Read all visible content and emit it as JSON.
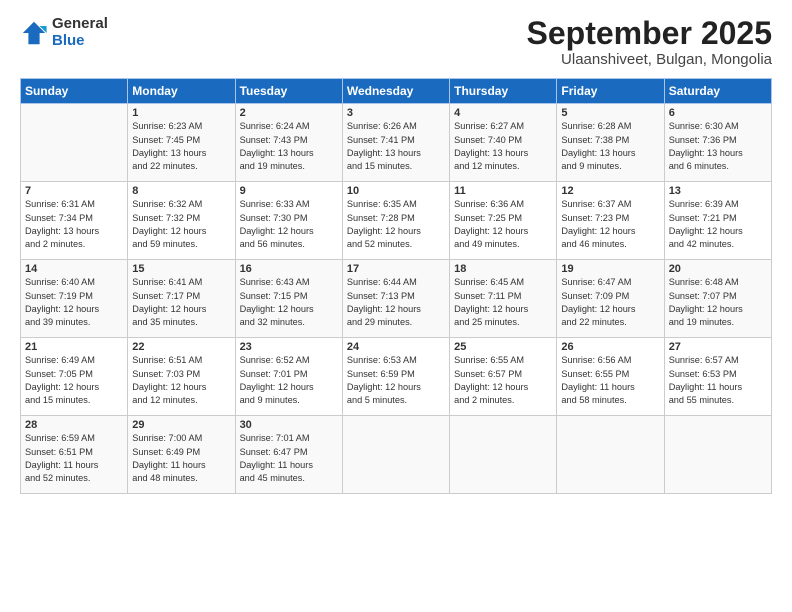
{
  "logo": {
    "general": "General",
    "blue": "Blue"
  },
  "title": "September 2025",
  "subtitle": "Ulaanshiveet, Bulgan, Mongolia",
  "days_header": [
    "Sunday",
    "Monday",
    "Tuesday",
    "Wednesday",
    "Thursday",
    "Friday",
    "Saturday"
  ],
  "weeks": [
    [
      {
        "day": "",
        "content": ""
      },
      {
        "day": "1",
        "content": "Sunrise: 6:23 AM\nSunset: 7:45 PM\nDaylight: 13 hours\nand 22 minutes."
      },
      {
        "day": "2",
        "content": "Sunrise: 6:24 AM\nSunset: 7:43 PM\nDaylight: 13 hours\nand 19 minutes."
      },
      {
        "day": "3",
        "content": "Sunrise: 6:26 AM\nSunset: 7:41 PM\nDaylight: 13 hours\nand 15 minutes."
      },
      {
        "day": "4",
        "content": "Sunrise: 6:27 AM\nSunset: 7:40 PM\nDaylight: 13 hours\nand 12 minutes."
      },
      {
        "day": "5",
        "content": "Sunrise: 6:28 AM\nSunset: 7:38 PM\nDaylight: 13 hours\nand 9 minutes."
      },
      {
        "day": "6",
        "content": "Sunrise: 6:30 AM\nSunset: 7:36 PM\nDaylight: 13 hours\nand 6 minutes."
      }
    ],
    [
      {
        "day": "7",
        "content": "Sunrise: 6:31 AM\nSunset: 7:34 PM\nDaylight: 13 hours\nand 2 minutes."
      },
      {
        "day": "8",
        "content": "Sunrise: 6:32 AM\nSunset: 7:32 PM\nDaylight: 12 hours\nand 59 minutes."
      },
      {
        "day": "9",
        "content": "Sunrise: 6:33 AM\nSunset: 7:30 PM\nDaylight: 12 hours\nand 56 minutes."
      },
      {
        "day": "10",
        "content": "Sunrise: 6:35 AM\nSunset: 7:28 PM\nDaylight: 12 hours\nand 52 minutes."
      },
      {
        "day": "11",
        "content": "Sunrise: 6:36 AM\nSunset: 7:25 PM\nDaylight: 12 hours\nand 49 minutes."
      },
      {
        "day": "12",
        "content": "Sunrise: 6:37 AM\nSunset: 7:23 PM\nDaylight: 12 hours\nand 46 minutes."
      },
      {
        "day": "13",
        "content": "Sunrise: 6:39 AM\nSunset: 7:21 PM\nDaylight: 12 hours\nand 42 minutes."
      }
    ],
    [
      {
        "day": "14",
        "content": "Sunrise: 6:40 AM\nSunset: 7:19 PM\nDaylight: 12 hours\nand 39 minutes."
      },
      {
        "day": "15",
        "content": "Sunrise: 6:41 AM\nSunset: 7:17 PM\nDaylight: 12 hours\nand 35 minutes."
      },
      {
        "day": "16",
        "content": "Sunrise: 6:43 AM\nSunset: 7:15 PM\nDaylight: 12 hours\nand 32 minutes."
      },
      {
        "day": "17",
        "content": "Sunrise: 6:44 AM\nSunset: 7:13 PM\nDaylight: 12 hours\nand 29 minutes."
      },
      {
        "day": "18",
        "content": "Sunrise: 6:45 AM\nSunset: 7:11 PM\nDaylight: 12 hours\nand 25 minutes."
      },
      {
        "day": "19",
        "content": "Sunrise: 6:47 AM\nSunset: 7:09 PM\nDaylight: 12 hours\nand 22 minutes."
      },
      {
        "day": "20",
        "content": "Sunrise: 6:48 AM\nSunset: 7:07 PM\nDaylight: 12 hours\nand 19 minutes."
      }
    ],
    [
      {
        "day": "21",
        "content": "Sunrise: 6:49 AM\nSunset: 7:05 PM\nDaylight: 12 hours\nand 15 minutes."
      },
      {
        "day": "22",
        "content": "Sunrise: 6:51 AM\nSunset: 7:03 PM\nDaylight: 12 hours\nand 12 minutes."
      },
      {
        "day": "23",
        "content": "Sunrise: 6:52 AM\nSunset: 7:01 PM\nDaylight: 12 hours\nand 9 minutes."
      },
      {
        "day": "24",
        "content": "Sunrise: 6:53 AM\nSunset: 6:59 PM\nDaylight: 12 hours\nand 5 minutes."
      },
      {
        "day": "25",
        "content": "Sunrise: 6:55 AM\nSunset: 6:57 PM\nDaylight: 12 hours\nand 2 minutes."
      },
      {
        "day": "26",
        "content": "Sunrise: 6:56 AM\nSunset: 6:55 PM\nDaylight: 11 hours\nand 58 minutes."
      },
      {
        "day": "27",
        "content": "Sunrise: 6:57 AM\nSunset: 6:53 PM\nDaylight: 11 hours\nand 55 minutes."
      }
    ],
    [
      {
        "day": "28",
        "content": "Sunrise: 6:59 AM\nSunset: 6:51 PM\nDaylight: 11 hours\nand 52 minutes."
      },
      {
        "day": "29",
        "content": "Sunrise: 7:00 AM\nSunset: 6:49 PM\nDaylight: 11 hours\nand 48 minutes."
      },
      {
        "day": "30",
        "content": "Sunrise: 7:01 AM\nSunset: 6:47 PM\nDaylight: 11 hours\nand 45 minutes."
      },
      {
        "day": "",
        "content": ""
      },
      {
        "day": "",
        "content": ""
      },
      {
        "day": "",
        "content": ""
      },
      {
        "day": "",
        "content": ""
      }
    ]
  ]
}
